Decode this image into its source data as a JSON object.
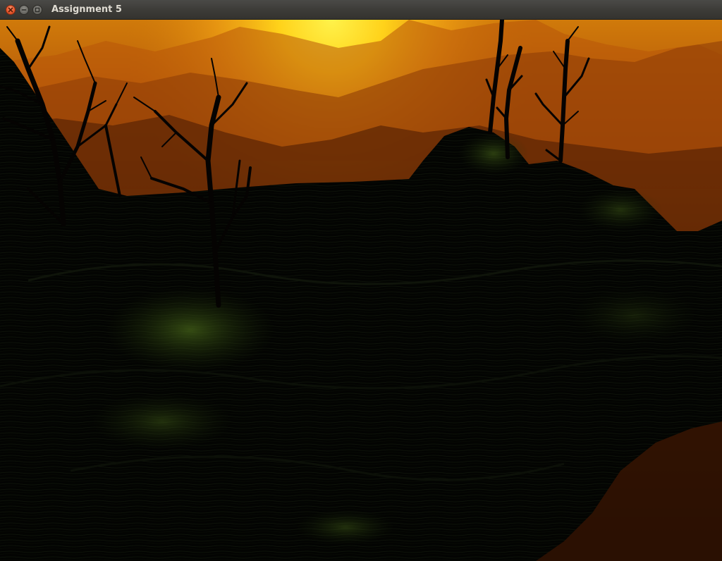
{
  "window": {
    "title": "Assignment 5",
    "controls": {
      "close": "close-icon",
      "minimize": "minimize-icon",
      "maximize": "maximize-icon"
    }
  },
  "scene": {
    "description_colors": {
      "sky_top": "#c9720a",
      "sun_glow": "#ffd21a",
      "haze": "#8a3f06",
      "terrain": "#030402",
      "grass_highlight": "#3a5416"
    }
  }
}
